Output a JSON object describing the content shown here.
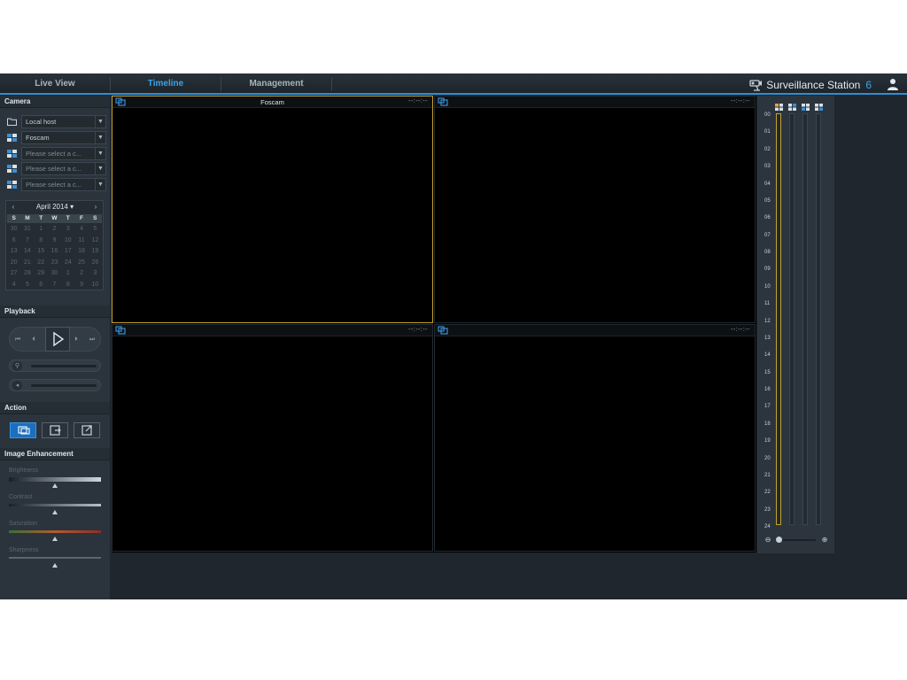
{
  "tabs": [
    {
      "label": "Live View",
      "active": false
    },
    {
      "label": "Timeline",
      "active": true
    },
    {
      "label": "Management",
      "active": false
    }
  ],
  "brand": {
    "name": "Surveillance Station",
    "version": "6"
  },
  "sidebar": {
    "camera_title": "Camera",
    "cameras": [
      {
        "value": "Local host",
        "icon": "folder-icon"
      },
      {
        "value": "Foscam",
        "icon": "camera-grid-icon"
      },
      {
        "value": "Please select a c...",
        "icon": "camera-grid-icon"
      },
      {
        "value": "Please select a c...",
        "icon": "camera-grid-icon"
      },
      {
        "value": "Please select a c...",
        "icon": "camera-grid-icon"
      }
    ],
    "calendar": {
      "prev": "‹",
      "next": "›",
      "title": "April 2014 ▾",
      "weekdays": [
        "S",
        "M",
        "T",
        "W",
        "T",
        "F",
        "S"
      ],
      "days": [
        "30",
        "31",
        "1",
        "2",
        "3",
        "4",
        "5",
        "6",
        "7",
        "8",
        "9",
        "10",
        "11",
        "12",
        "13",
        "14",
        "15",
        "16",
        "17",
        "18",
        "19",
        "20",
        "21",
        "22",
        "23",
        "24",
        "25",
        "26",
        "27",
        "28",
        "29",
        "30",
        "1",
        "2",
        "3",
        "4",
        "5",
        "6",
        "7",
        "8",
        "9",
        "10"
      ]
    },
    "playback_title": "Playback",
    "action_title": "Action",
    "enhancement_title": "Image Enhancement",
    "enhancement": [
      {
        "label": "Brightness",
        "level": 0.5
      },
      {
        "label": "Contrast",
        "level": 0.5
      },
      {
        "label": "Saturation",
        "level": 0.5
      },
      {
        "label": "Sharpness",
        "level": 0.5
      }
    ]
  },
  "panes": [
    {
      "title": "Foscam",
      "time": "--:--:--",
      "selected": true
    },
    {
      "title": "",
      "time": "--:--:--",
      "selected": false
    },
    {
      "title": "",
      "time": "--:--:--",
      "selected": false
    },
    {
      "title": "",
      "time": "--:--:--",
      "selected": false
    }
  ],
  "timeline": {
    "hours": [
      "00",
      "01",
      "02",
      "03",
      "04",
      "05",
      "06",
      "07",
      "08",
      "09",
      "10",
      "11",
      "12",
      "13",
      "14",
      "15",
      "16",
      "17",
      "18",
      "19",
      "20",
      "21",
      "22",
      "23",
      "24"
    ]
  },
  "colors": {
    "accent": "#3aa3e8",
    "selected": "#c5a22e",
    "active_button": "#1c6fbf"
  }
}
